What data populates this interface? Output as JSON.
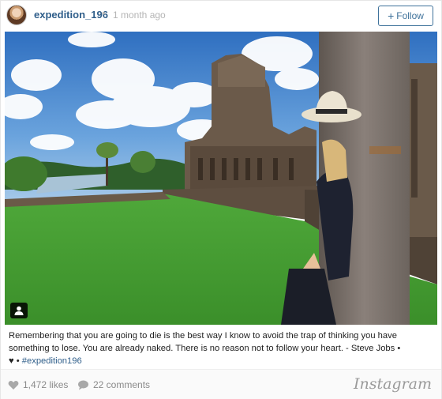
{
  "header": {
    "username": "expedition_196",
    "separator": "•",
    "time_ago": "1 month ago",
    "follow_label": "Follow",
    "follow_icon": "plus-icon"
  },
  "photo": {
    "tag_icon": "user-tag-icon"
  },
  "caption": {
    "text": "Remembering that you are going to die is the best way I know to avoid the trap of thinking you have something to lose. You are already naked. There is no reason not to follow your heart. - Steve Jobs •",
    "heart_icon": "heart-icon",
    "separator": "•",
    "hashtag": "#expedition196"
  },
  "footer": {
    "likes": "1,472 likes",
    "comments": "22 comments",
    "brand": "Instagram",
    "like_icon": "heart-icon",
    "comment_icon": "speech-bubble-icon"
  },
  "colors": {
    "link": "#2f5e8a",
    "follow": "#3f729b",
    "muted": "#8a8a8a"
  }
}
